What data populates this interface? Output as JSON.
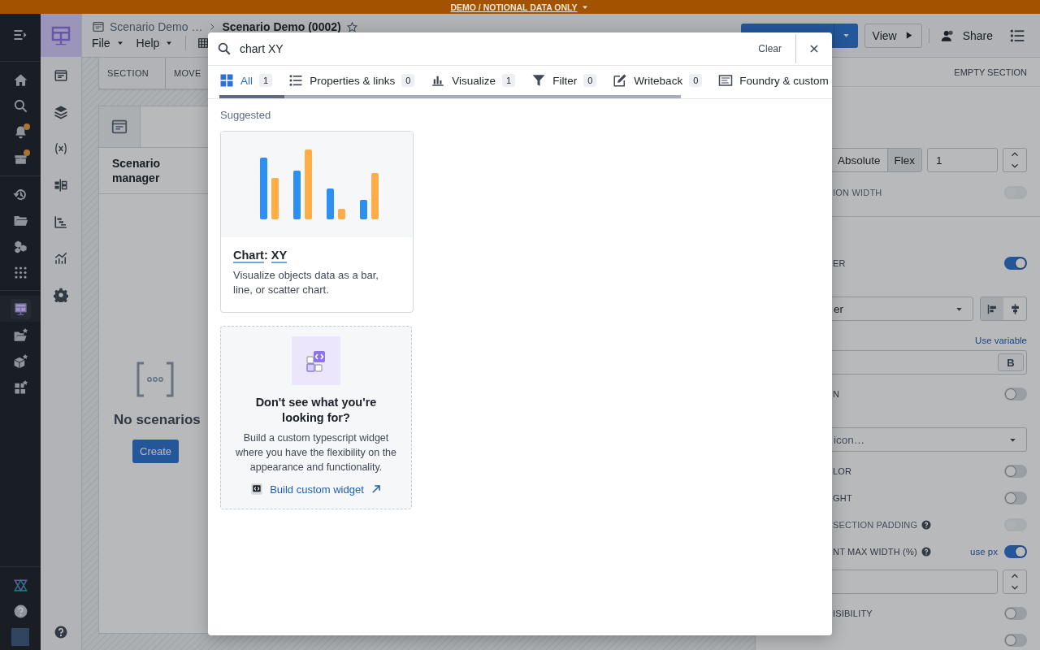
{
  "banner": {
    "text": "DEMO / NOTIONAL DATA ONLY"
  },
  "nav": {
    "items": [
      {
        "selected": false,
        "badge": false
      },
      {
        "selected": false,
        "badge": false
      },
      {
        "selected": false,
        "badge": false
      },
      {
        "selected": false,
        "badge": true
      },
      {
        "selected": false,
        "badge": true
      },
      {
        "selected": false,
        "badge": false
      },
      {
        "selected": false,
        "badge": false
      },
      {
        "selected": false,
        "badge": false
      },
      {
        "selected": false,
        "badge": false
      },
      {
        "selected": true,
        "badge": false
      },
      {
        "selected": false,
        "badge": false
      },
      {
        "selected": false,
        "badge": false
      },
      {
        "selected": false,
        "badge": false
      }
    ]
  },
  "header": {
    "breadcrumb": [
      "Scenario Demo …",
      "Scenario Demo (0002)"
    ],
    "menus": [
      "File",
      "Help"
    ],
    "view_button": "View",
    "share_button": "Share"
  },
  "toolbar": [
    "SECTION",
    "MOVE"
  ],
  "widget": {
    "title": "Scenario manager",
    "empty_text": "No scenarios",
    "create_button": "Create"
  },
  "panel": {
    "header": "EMPTY SECTION",
    "rows": [
      {
        "kind": "sizing",
        "options": [
          {
            "label": "Absolute",
            "selected": false
          },
          {
            "label": "Flex",
            "selected": true
          }
        ],
        "value": "1"
      },
      {
        "kind": "toggle",
        "label": "ION WIDTH",
        "on": false,
        "disabled": true
      },
      {
        "kind": "divider"
      },
      {
        "kind": "toggle",
        "label": "ER",
        "on": true,
        "disabled": false
      },
      {
        "kind": "select",
        "value": "er",
        "align": [
          {
            "selected": true
          },
          {
            "selected": false
          }
        ]
      },
      {
        "kind": "text_field",
        "link": "Use variable",
        "button": "B"
      },
      {
        "kind": "toggle",
        "label": "N",
        "on": false,
        "disabled": false
      },
      {
        "kind": "select",
        "placeholder": "icon…"
      },
      {
        "kind": "toggle",
        "label": "LOR",
        "on": false,
        "disabled": false
      },
      {
        "kind": "toggle",
        "label": "GHT",
        "on": false,
        "disabled": false
      },
      {
        "kind": "toggle",
        "label": "SECTION PADDING",
        "help": true,
        "on": false,
        "disabled": true
      },
      {
        "kind": "toggle",
        "label": "NT MAX WIDTH (%)",
        "help": true,
        "link": "use px",
        "on": true,
        "disabled": false
      },
      {
        "kind": "number_field"
      },
      {
        "kind": "toggle",
        "label": "ISIBILITY",
        "on": false,
        "disabled": false
      },
      {
        "kind": "toggle",
        "on": false,
        "disabled": false
      }
    ]
  },
  "dialog": {
    "search": {
      "value": "chart XY"
    },
    "clear": "Clear",
    "tabs": [
      {
        "label": "All",
        "count": "1",
        "selected": true
      },
      {
        "label": "Properties & links",
        "count": "0",
        "selected": false
      },
      {
        "label": "Visualize",
        "count": "1",
        "selected": false
      },
      {
        "label": "Filter",
        "count": "0",
        "selected": false
      },
      {
        "label": "Writeback",
        "count": "0",
        "selected": false
      },
      {
        "label": "Foundry & custom",
        "selected": false
      }
    ],
    "section": "Suggested",
    "results": [
      {
        "title_parts": [
          {
            "text": "Chart",
            "matched": true
          },
          {
            "text": ": ",
            "matched": false
          },
          {
            "text": "XY",
            "matched": true
          }
        ],
        "description": "Visualize objects data as a bar, line, or scatter chart."
      }
    ],
    "custom": {
      "title": "Don't see what you're looking for?",
      "text": "Build a custom typescript widget where you have the flexibility on the appearance and functionality.",
      "link": "Build custom widget"
    }
  }
}
